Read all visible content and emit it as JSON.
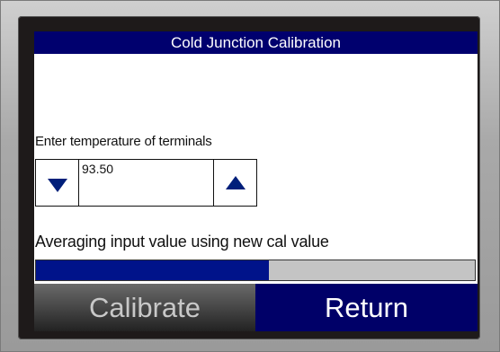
{
  "window": {
    "title": "Cold Junction Calibration"
  },
  "entry": {
    "prompt": "Enter temperature of terminals",
    "value": "93.50",
    "decrement_icon": "triangle-down-icon",
    "increment_icon": "triangle-up-icon"
  },
  "status": {
    "message": "Averaging input value using new cal value",
    "progress_percent": 53
  },
  "actions": {
    "calibrate_label": "Calibrate",
    "return_label": "Return"
  },
  "colors": {
    "title_bar": "#00006e",
    "accent": "#001f7a",
    "progress_fill": "#00138a",
    "progress_track": "#c4c4c4",
    "return_button": "#000068"
  }
}
